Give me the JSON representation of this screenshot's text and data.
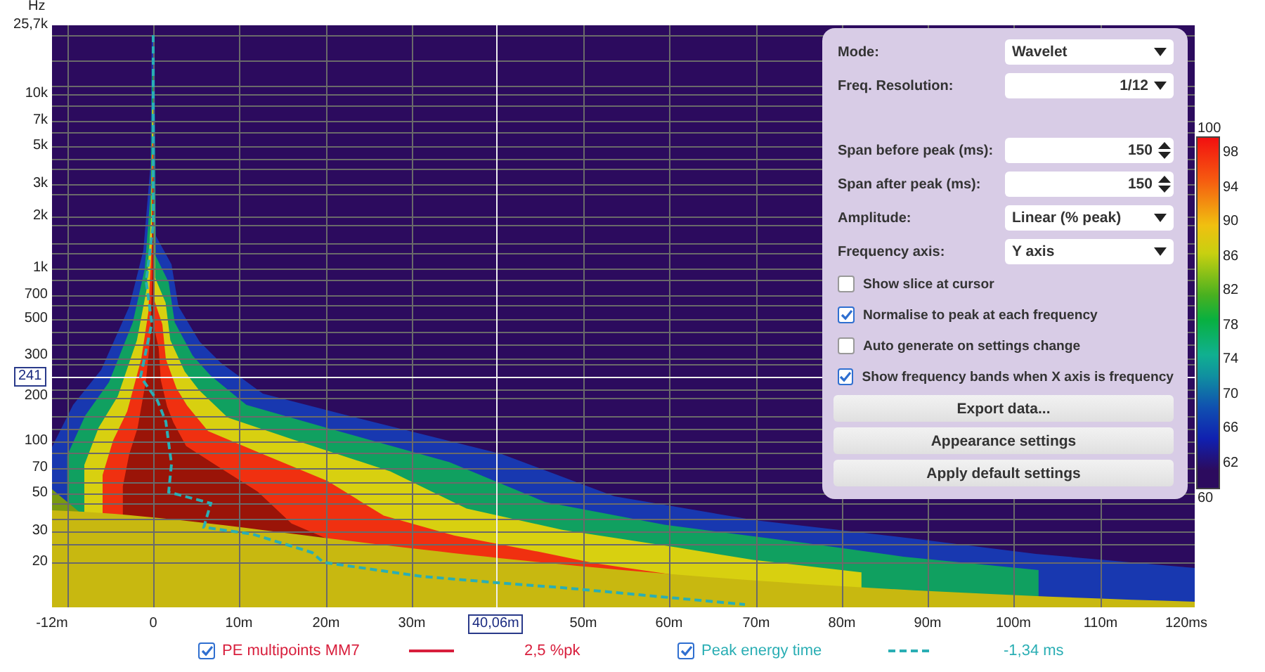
{
  "plot": {
    "y_unit": "Hz",
    "y_ticks": [
      "25,7k",
      "10k",
      "7k",
      "5k",
      "3k",
      "2k",
      "1k",
      "700",
      "500",
      "300",
      "200",
      "100",
      "70",
      "50",
      "30",
      "20"
    ],
    "x_ticks": [
      "-12m",
      "0",
      "10m",
      "20m",
      "30m",
      "50m",
      "60m",
      "70m",
      "80m",
      "90m",
      "100m",
      "110m",
      "120ms"
    ],
    "cursor": {
      "frequency": "241",
      "time": "40,06m"
    }
  },
  "color_scale": {
    "max": "100",
    "ticks": [
      "98",
      "94",
      "90",
      "86",
      "82",
      "78",
      "74",
      "70",
      "66",
      "62"
    ],
    "min": "60"
  },
  "settings": {
    "sections": [
      [
        {
          "kind": "dropdown",
          "label": "Mode:",
          "value": "Wavelet",
          "right_aligned": false
        },
        {
          "kind": "dropdown",
          "label": "Freq. Resolution:",
          "value": "1/12",
          "right_aligned": true
        }
      ],
      [
        {
          "kind": "spinner",
          "label": "Span before peak (ms):",
          "value": "150"
        },
        {
          "kind": "spinner",
          "label": "Span after peak (ms):",
          "value": "150"
        },
        {
          "kind": "dropdown",
          "label": "Amplitude:",
          "value": "Linear (% peak)",
          "right_aligned": false
        },
        {
          "kind": "dropdown",
          "label": "Frequency axis:",
          "value": "Y axis",
          "right_aligned": false
        },
        {
          "kind": "checkbox",
          "label": "Show slice at cursor",
          "checked": false
        },
        {
          "kind": "checkbox",
          "label": "Normalise to peak at each frequency",
          "checked": true
        },
        {
          "kind": "checkbox",
          "label": "Auto generate on settings change",
          "checked": false
        },
        {
          "kind": "checkbox",
          "label": "Show frequency bands when X axis is frequency",
          "checked": true
        },
        {
          "kind": "button",
          "label": "Export data..."
        },
        {
          "kind": "button",
          "label": "Appearance settings"
        },
        {
          "kind": "button",
          "label": "Apply default settings"
        }
      ]
    ]
  },
  "legend": [
    {
      "checked": true,
      "name": "PE multipoints MM7",
      "dashed": false,
      "reading": "2,5 %pk",
      "color": "#d81e3c"
    },
    {
      "checked": true,
      "name": "Peak energy time",
      "dashed": true,
      "reading": "-1,34 ms",
      "color": "#2aaeb4"
    }
  ]
}
